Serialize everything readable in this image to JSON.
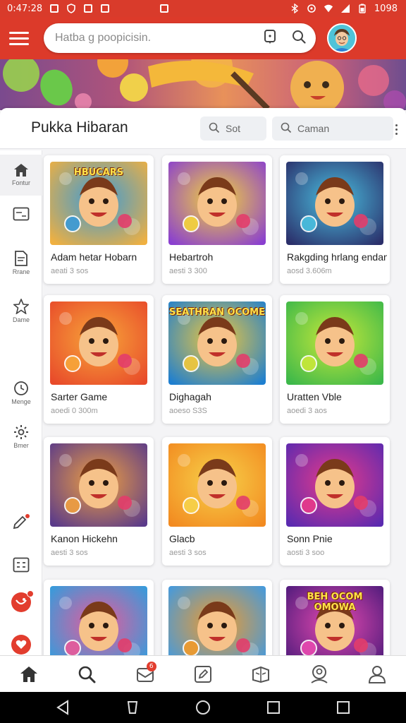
{
  "status_bar": {
    "time": "0:47:28",
    "battery": "1098"
  },
  "header": {
    "search_placeholder": "Hatba g poopicisin.",
    "icons": [
      "menu-icon",
      "notification-icon",
      "search-icon",
      "avatar"
    ]
  },
  "panel": {
    "title": "Pukka Hibaran",
    "sort_label": "Sot",
    "filter_label": "Caman",
    "accent": "#dc3a2a"
  },
  "sidebar": {
    "items": [
      {
        "label": "Fontur",
        "icon": "home-icon"
      },
      {
        "label": "",
        "icon": "inbox-icon"
      },
      {
        "label": "Rrane",
        "icon": "document-icon"
      },
      {
        "label": "Dame",
        "icon": "star-icon"
      },
      {
        "label": "Menge",
        "icon": "clock-icon"
      },
      {
        "label": "Bmer",
        "icon": "gear-icon"
      },
      {
        "label": "",
        "icon": "edit-icon"
      },
      {
        "label": "",
        "icon": "grid-icon"
      },
      {
        "label": "",
        "icon": "game-icon"
      },
      {
        "label": "",
        "icon": "heart-icon"
      }
    ]
  },
  "games": [
    {
      "title": "Adam hetar Hobarn",
      "meta": "aeati 3 sos",
      "thumb_text": "HBUCARS",
      "palette": [
        "#f0b040",
        "#3a9ad8"
      ]
    },
    {
      "title": "Hebartroh",
      "meta": "aesti 3 300",
      "thumb_text": "",
      "palette": [
        "#8a3fd0",
        "#f5d43a"
      ]
    },
    {
      "title": "Rakgding hrlang endan",
      "meta": "aosd 3.606m",
      "thumb_text": "",
      "palette": [
        "#2b2f6a",
        "#4ac0e0"
      ]
    },
    {
      "title": "Sarter Game",
      "meta": "aoedi 0 300m",
      "thumb_text": "",
      "palette": [
        "#e84a2a",
        "#f7a63a"
      ]
    },
    {
      "title": "Dighagah",
      "meta": "aoeso S3S",
      "thumb_text": "SEATHRAN OCOME",
      "palette": [
        "#1e7fd0",
        "#f2c83a"
      ]
    },
    {
      "title": "Uratten Vble",
      "meta": "aoedi 3 aos",
      "thumb_text": "",
      "palette": [
        "#3cb84a",
        "#c8e83a"
      ]
    },
    {
      "title": "Kanon Hickehn",
      "meta": "aesti 3 sos",
      "thumb_text": "",
      "palette": [
        "#5a3a8a",
        "#f0a040"
      ]
    },
    {
      "title": "Glacb",
      "meta": "aesti 3 sos",
      "thumb_text": "",
      "palette": [
        "#f28a20",
        "#f7d24a"
      ]
    },
    {
      "title": "Sonn Pnie",
      "meta": "aosti 3 soo",
      "thumb_text": "",
      "palette": [
        "#5a2ab0",
        "#e83a8a"
      ]
    },
    {
      "title": "",
      "meta": "",
      "thumb_text": "",
      "palette": [
        "#2aa0e0",
        "#e85a9a"
      ]
    },
    {
      "title": "",
      "meta": "",
      "thumb_text": "",
      "palette": [
        "#3a9ae8",
        "#f29a2a"
      ]
    },
    {
      "title": "",
      "meta": "",
      "thumb_text": "BEH OCOM OMOWA",
      "palette": [
        "#4a1a7a",
        "#e84ab0"
      ]
    }
  ],
  "bottom_nav": {
    "items": [
      "home-icon",
      "search-icon",
      "inbox-icon",
      "edit-icon",
      "library-icon",
      "community-icon",
      "profile-icon"
    ],
    "badge": "6"
  }
}
